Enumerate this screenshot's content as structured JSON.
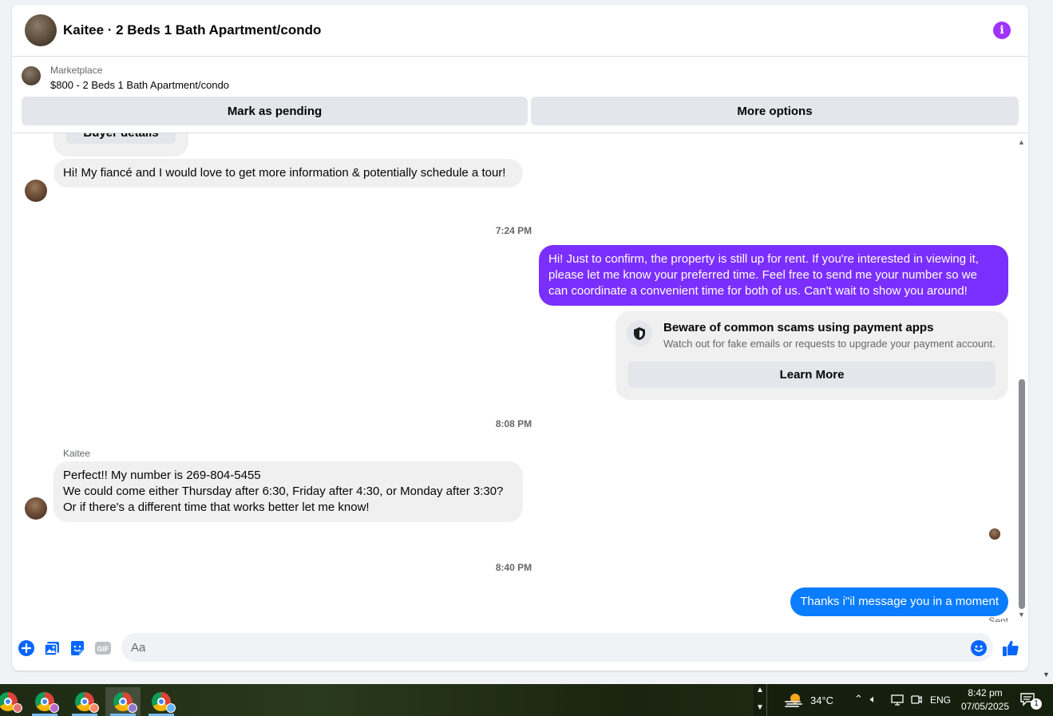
{
  "header": {
    "title": "Kaitee · 2 Beds 1 Bath Apartment/condo",
    "info_icon": "i"
  },
  "listing": {
    "label": "Marketplace",
    "title": "$800 - 2 Beds 1 Bath Apartment/condo",
    "mark_pending": "Mark as pending",
    "more_options": "More options",
    "buyer_details": "Buyer details"
  },
  "messages": {
    "msg1": "Hi! My fiancé and I would love to get more information & potentially schedule a tour!",
    "time1": "7:24 PM",
    "msg2": "Hi! Just to confirm, the property is still up for rent. If you're interested in viewing it, please let me know your preferred time. Feel free to send me your number so we can coordinate a convenient time for both of us. Can't wait to show you around!",
    "scam_title": "Beware of common scams using payment apps",
    "scam_sub": "Watch out for fake emails or requests to upgrade your payment account.",
    "learn_more": "Learn More",
    "time2": "8:08 PM",
    "sender": "Kaitee",
    "msg3_line1": "Perfect!! My number is 269-804-5455",
    "msg3_line2": "We could come either Thursday after 6:30, Friday after 4:30, or Monday after 3:30? Or if there's a different time that works better let me know!",
    "time3": "8:40 PM",
    "msg4": "Thanks i\"il message you in a moment",
    "sent": "Sent"
  },
  "composer": {
    "placeholder": "Aa",
    "gif_label": "GIF"
  },
  "taskbar": {
    "weather": "34°C",
    "language": "ENG",
    "time": "8:42 pm",
    "date": "07/05/2025",
    "notification_count": "1"
  },
  "colors": {
    "accent_purple": "#a033ff",
    "bubble_purple": "#7b2fff",
    "bubble_blue": "#0a7cff",
    "messenger_blue": "#0866ff"
  }
}
